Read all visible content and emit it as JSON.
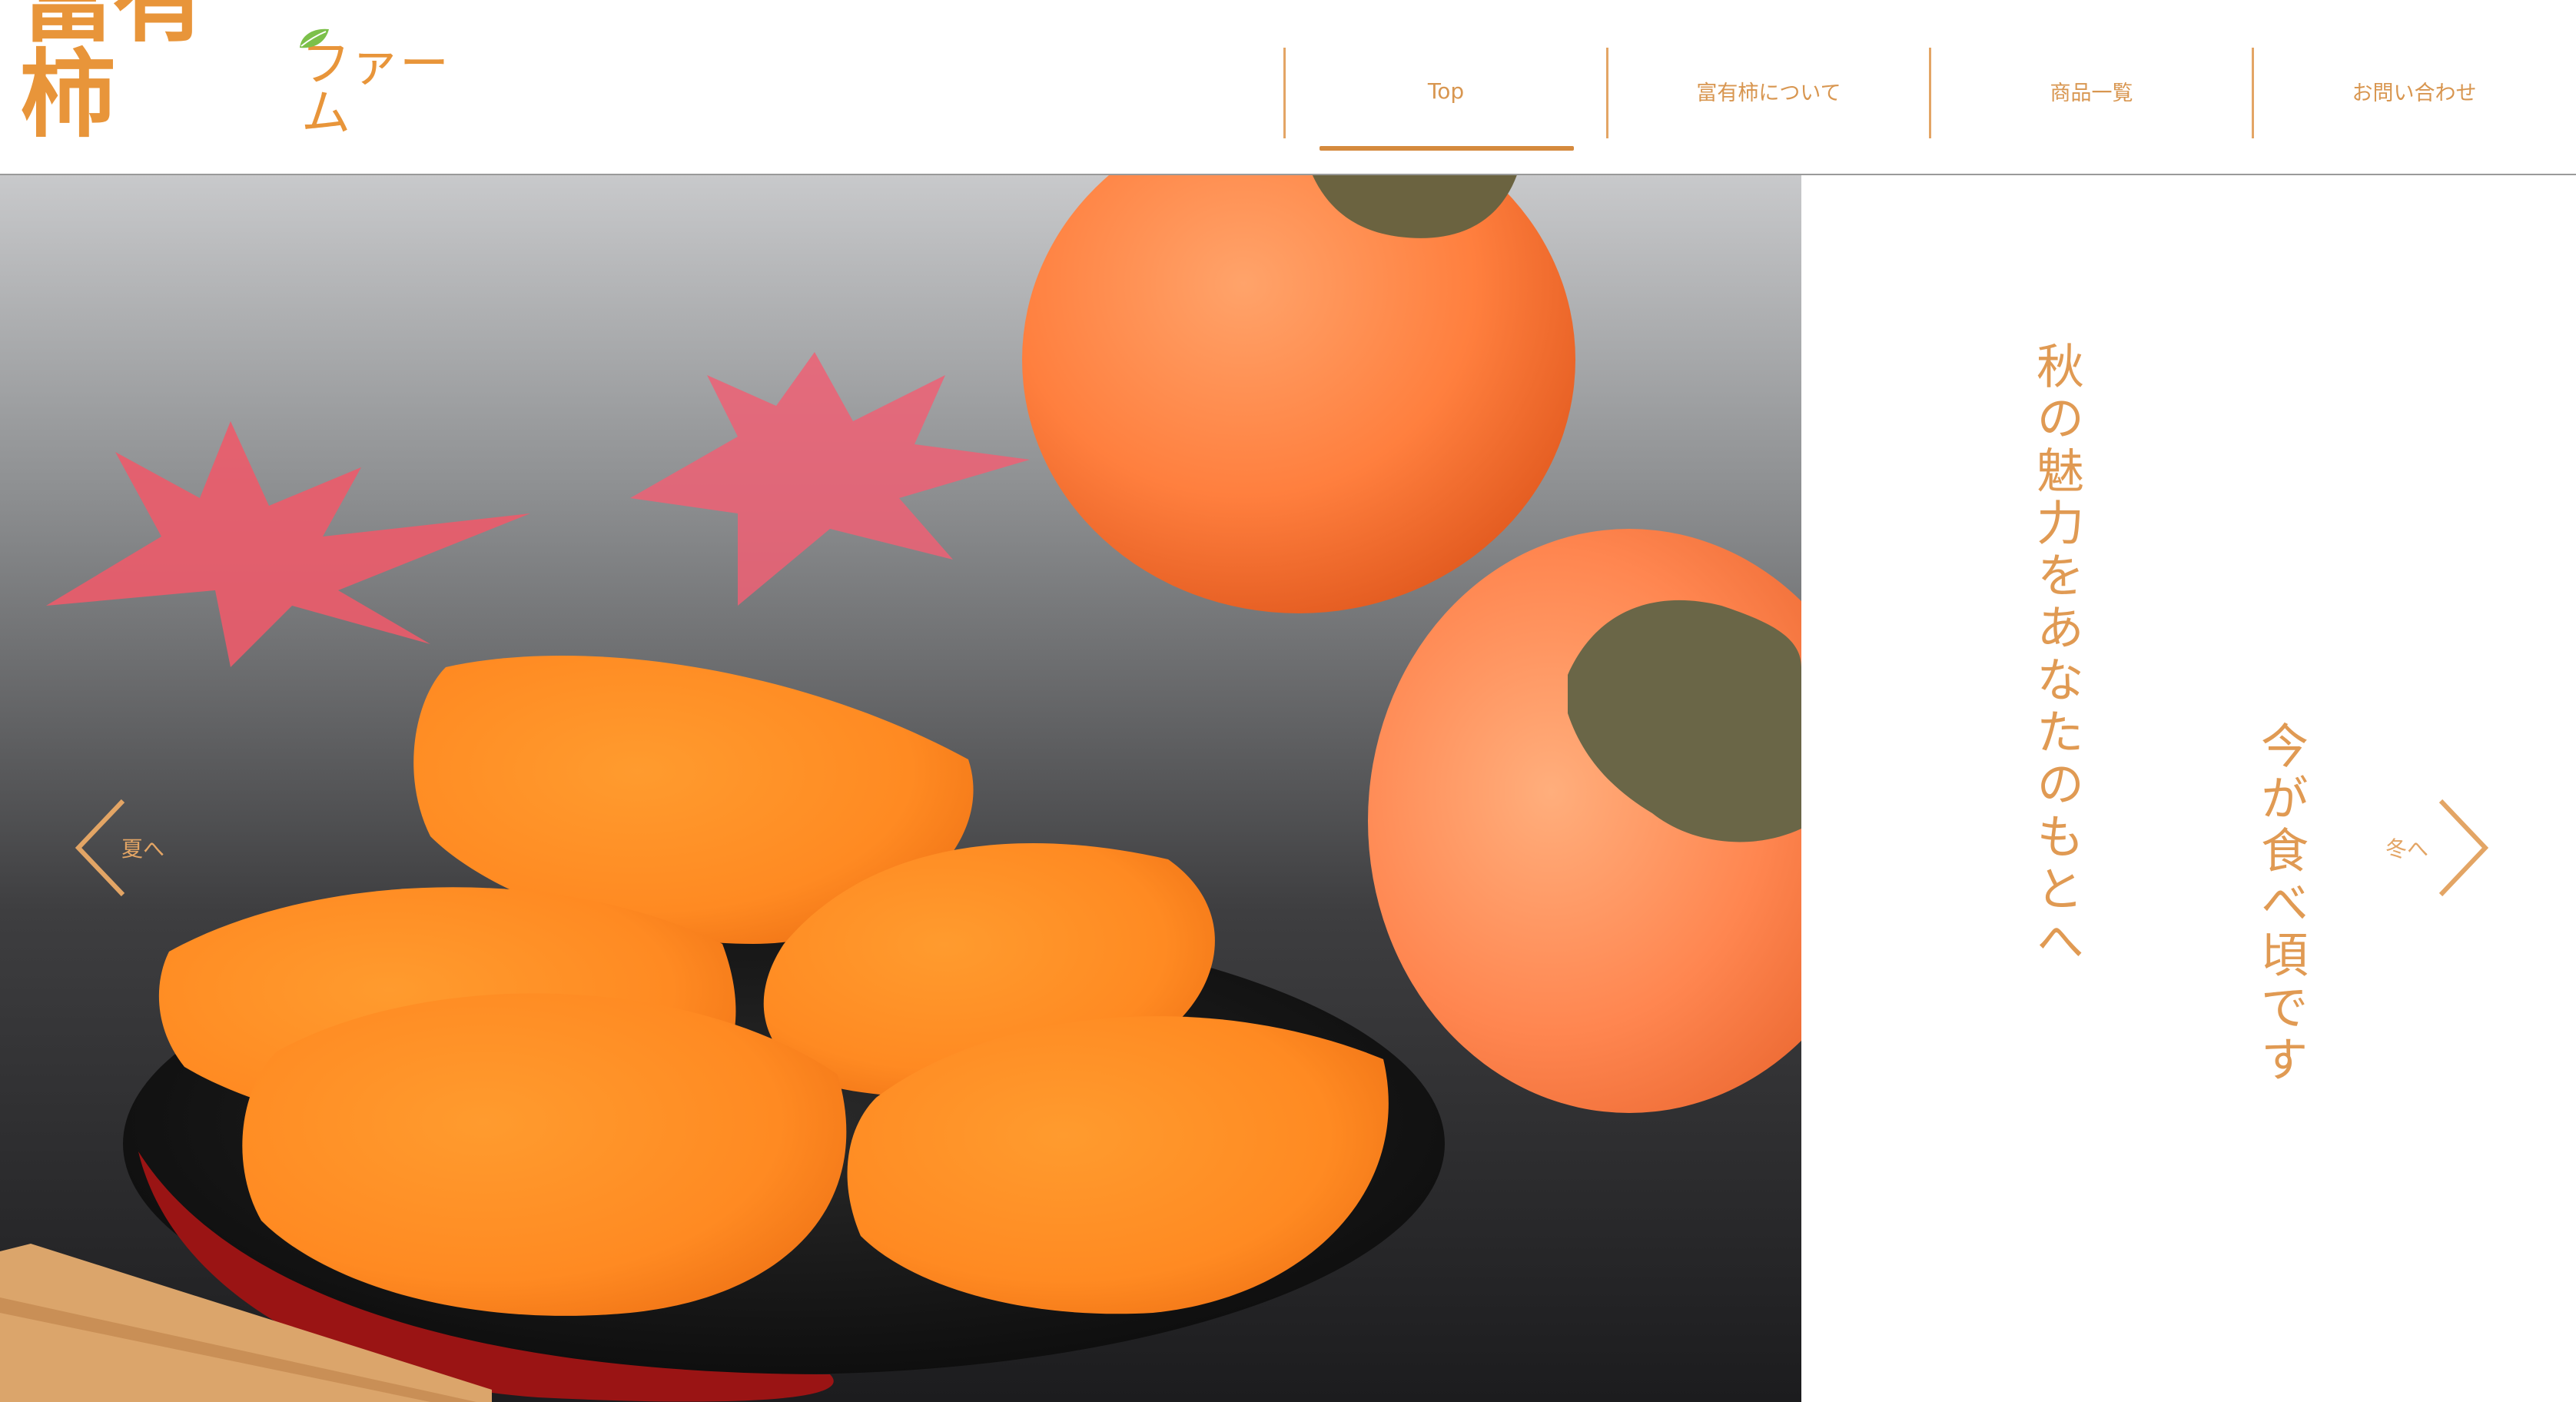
{
  "header": {
    "logo_main": "富有柿",
    "logo_sub": "ファーム",
    "nav": [
      {
        "label": "Top",
        "active": true
      },
      {
        "label": "富有柿について",
        "active": false
      },
      {
        "label": "商品一覧",
        "active": false
      },
      {
        "label": "お問い合わせ",
        "active": false
      }
    ]
  },
  "hero": {
    "headline": "秋の魅力をあなたのもとへ",
    "subline": "今が食べ頃です",
    "prev_label": "夏へ",
    "next_label": "冬へ",
    "image_alt": "persimmon-slices-on-lacquer-plate"
  },
  "colors": {
    "accent": "#e09a53",
    "nav_text": "#d89650",
    "divider": "#e3a565",
    "logo": "#e8953a"
  }
}
